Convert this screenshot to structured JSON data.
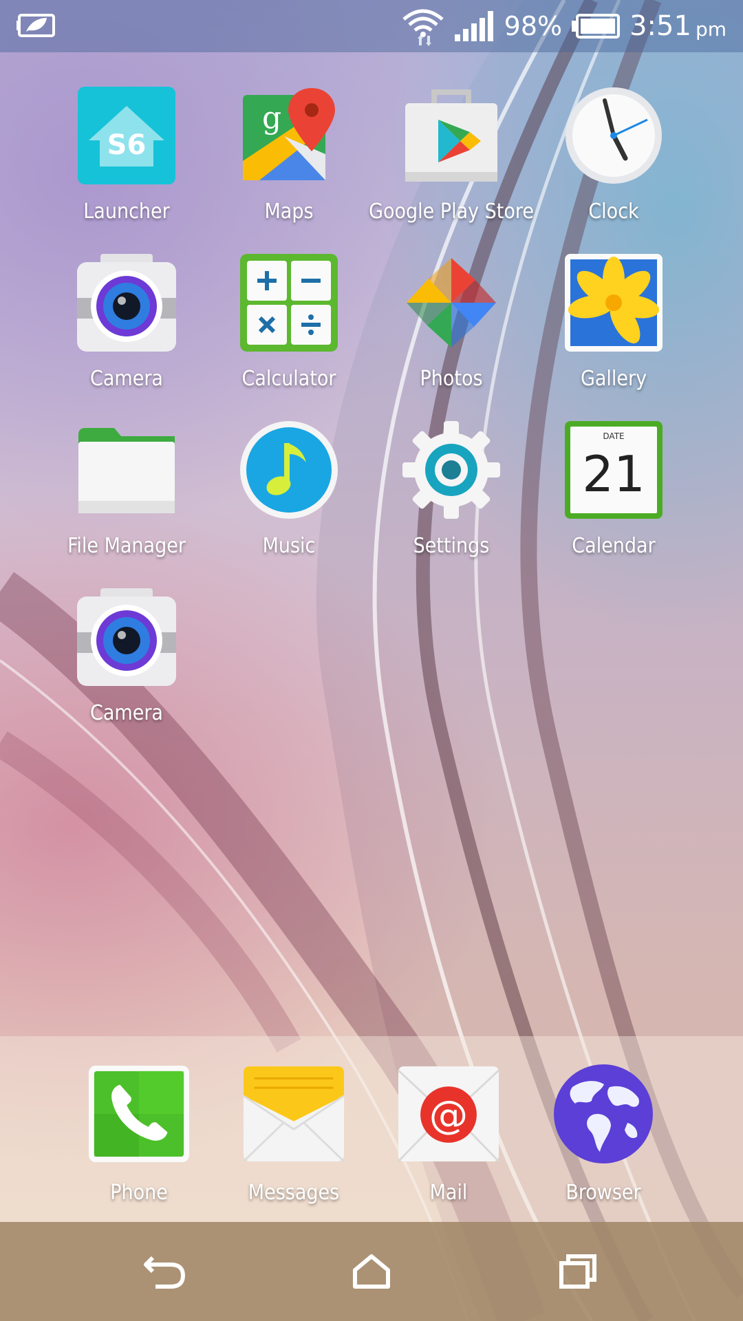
{
  "status_bar": {
    "battery_percent": "98%",
    "time": "3:51",
    "ampm": "pm",
    "icons": [
      "eco-battery-icon",
      "wifi-icon",
      "signal-icon",
      "battery-icon"
    ]
  },
  "apps": [
    {
      "label": "Launcher",
      "icon": "launcher-icon",
      "icon_text": "S6"
    },
    {
      "label": "Maps",
      "icon": "maps-icon"
    },
    {
      "label": "Google Play Store",
      "icon": "play-store-icon"
    },
    {
      "label": "Clock",
      "icon": "clock-icon"
    },
    {
      "label": "Camera",
      "icon": "camera-icon"
    },
    {
      "label": "Calculator",
      "icon": "calculator-icon"
    },
    {
      "label": "Photos",
      "icon": "photos-icon"
    },
    {
      "label": "Gallery",
      "icon": "gallery-icon"
    },
    {
      "label": "File Manager",
      "icon": "folder-icon"
    },
    {
      "label": "Music",
      "icon": "music-icon"
    },
    {
      "label": "Settings",
      "icon": "settings-icon"
    },
    {
      "label": "Calendar",
      "icon": "calendar-icon",
      "icon_caption": "DATE",
      "icon_text": "21"
    },
    {
      "label": "Camera",
      "icon": "camera-icon"
    }
  ],
  "dock": [
    {
      "label": "Phone",
      "icon": "phone-icon"
    },
    {
      "label": "Messages",
      "icon": "messages-icon"
    },
    {
      "label": "Mail",
      "icon": "mail-icon",
      "icon_text": "@"
    },
    {
      "label": "Browser",
      "icon": "globe-icon"
    }
  ],
  "nav_bar": {
    "buttons": [
      "back-icon",
      "home-icon",
      "recents-icon"
    ]
  }
}
